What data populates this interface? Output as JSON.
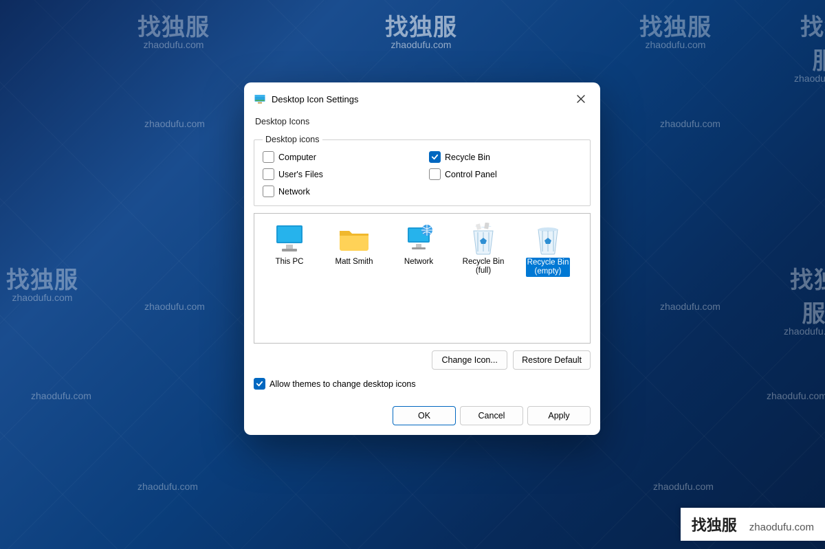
{
  "watermark": {
    "big": "找独服",
    "small": "zhaodufu.com"
  },
  "dialog": {
    "title": "Desktop Icon Settings",
    "tab": "Desktop Icons",
    "group_legend": "Desktop icons",
    "checks": {
      "computer": {
        "label": "Computer",
        "checked": false
      },
      "recycle_bin": {
        "label": "Recycle Bin",
        "checked": true
      },
      "users_files": {
        "label": "User's Files",
        "checked": false
      },
      "control_panel": {
        "label": "Control Panel",
        "checked": false
      },
      "network": {
        "label": "Network",
        "checked": false
      }
    },
    "icons": [
      {
        "id": "this-pc",
        "label": "This PC"
      },
      {
        "id": "user-folder",
        "label": "Matt Smith"
      },
      {
        "id": "network",
        "label": "Network"
      },
      {
        "id": "recycle-full",
        "label": "Recycle Bin\n(full)"
      },
      {
        "id": "recycle-empty",
        "label": "Recycle Bin\n(empty)",
        "selected": true
      }
    ],
    "buttons": {
      "change_icon": "Change Icon...",
      "restore_default": "Restore Default"
    },
    "allow_themes": {
      "label": "Allow themes to change desktop icons",
      "checked": true
    },
    "footer": {
      "ok": "OK",
      "cancel": "Cancel",
      "apply": "Apply"
    }
  }
}
